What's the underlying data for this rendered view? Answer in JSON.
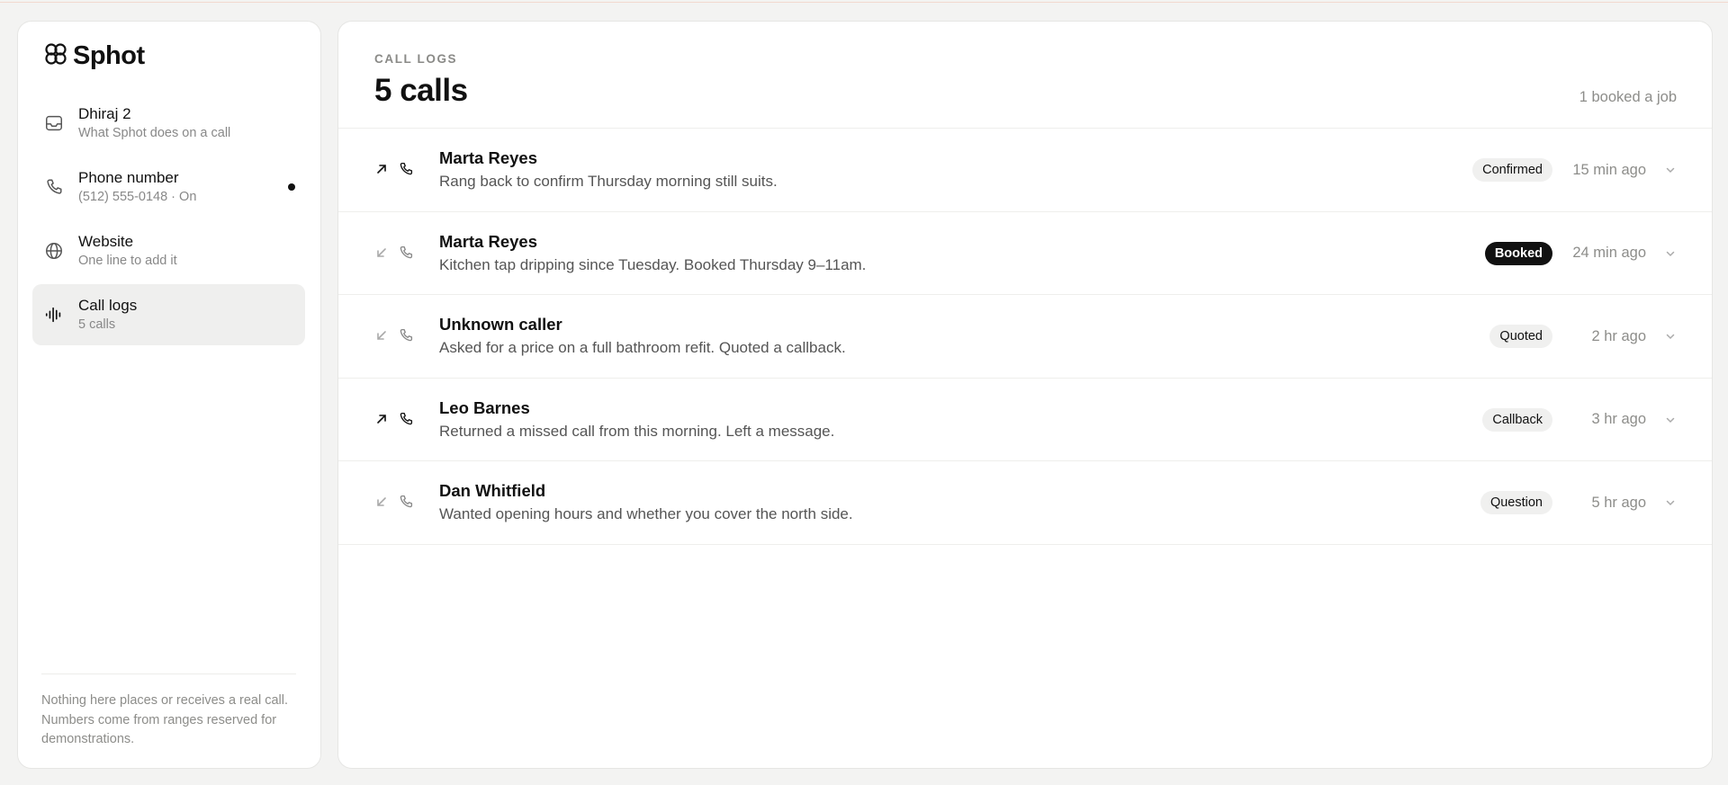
{
  "brand": {
    "name": "Sphot",
    "icon": "flower-logo-icon"
  },
  "sidebar": {
    "items": [
      {
        "title": "Dhiraj 2",
        "sub": "What Sphot does on a call",
        "icon": "inbox-icon"
      },
      {
        "title": "Phone number",
        "sub": "(512) 555-0148 · On",
        "icon": "phone-icon",
        "dot": true
      },
      {
        "title": "Website",
        "sub": "One line to add it",
        "icon": "globe-icon"
      },
      {
        "title": "Call logs",
        "sub": "5 calls",
        "icon": "audio-wave-icon",
        "active": true
      }
    ],
    "note": "Nothing here places or receives a real call. Numbers come from ranges reserved for demonstrations."
  },
  "main": {
    "eyebrow": "CALL LOGS",
    "title": "5 calls",
    "summary": "1 booked a job",
    "calls": [
      {
        "name": "Marta Reyes",
        "desc": "Rang back to confirm Thursday morning still suits.",
        "status": "Confirmed",
        "time": "15 min ago",
        "direction": "outgoing"
      },
      {
        "name": "Marta Reyes",
        "desc": "Kitchen tap dripping since Tuesday. Booked Thursday 9–11am.",
        "status": "Booked",
        "time": "24 min ago",
        "direction": "incoming",
        "highlight": true
      },
      {
        "name": "Unknown caller",
        "desc": "Asked for a price on a full bathroom refit. Quoted a callback.",
        "status": "Quoted",
        "time": "2 hr ago",
        "direction": "incoming"
      },
      {
        "name": "Leo Barnes",
        "desc": "Returned a missed call from this morning. Left a message.",
        "status": "Callback",
        "time": "3 hr ago",
        "direction": "outgoing"
      },
      {
        "name": "Dan Whitfield",
        "desc": "Wanted opening hours and whether you cover the north side.",
        "status": "Question",
        "time": "5 hr ago",
        "direction": "incoming"
      }
    ]
  },
  "colors": {
    "accent": "#111111",
    "muted": "#8d8d8a",
    "badge_bg": "#f0f0ef",
    "active_bg": "#efefee"
  }
}
